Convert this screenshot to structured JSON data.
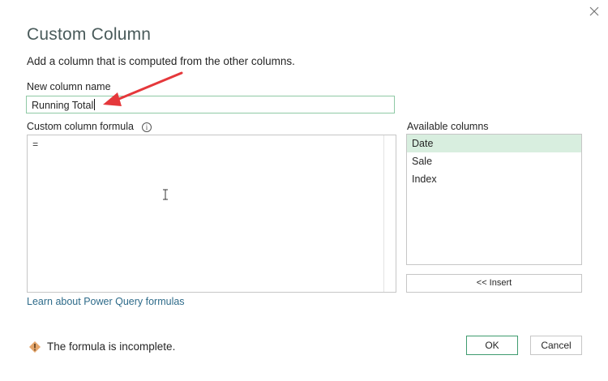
{
  "dialog": {
    "title": "Custom Column",
    "subtitle": "Add a column that is computed from the other columns.",
    "close_icon": "close-icon"
  },
  "new_column": {
    "label": "New column name",
    "value": "Running Total"
  },
  "formula": {
    "label": "Custom column formula",
    "info_icon": "info-icon",
    "value": "="
  },
  "available_columns": {
    "label": "Available columns",
    "items": [
      "Date",
      "Sale",
      "Index"
    ],
    "selected": "Date"
  },
  "insert_button": "<< Insert",
  "learn_link": "Learn about Power Query formulas",
  "status": {
    "icon": "warning-icon",
    "message": "The formula is incomplete."
  },
  "footer": {
    "ok_label": "OK",
    "cancel_label": "Cancel"
  },
  "colors": {
    "accent_green": "#3f9b6f",
    "selected_bg": "#d8eedf",
    "arrow_red": "#e5383b",
    "link": "#2e6b8a"
  }
}
